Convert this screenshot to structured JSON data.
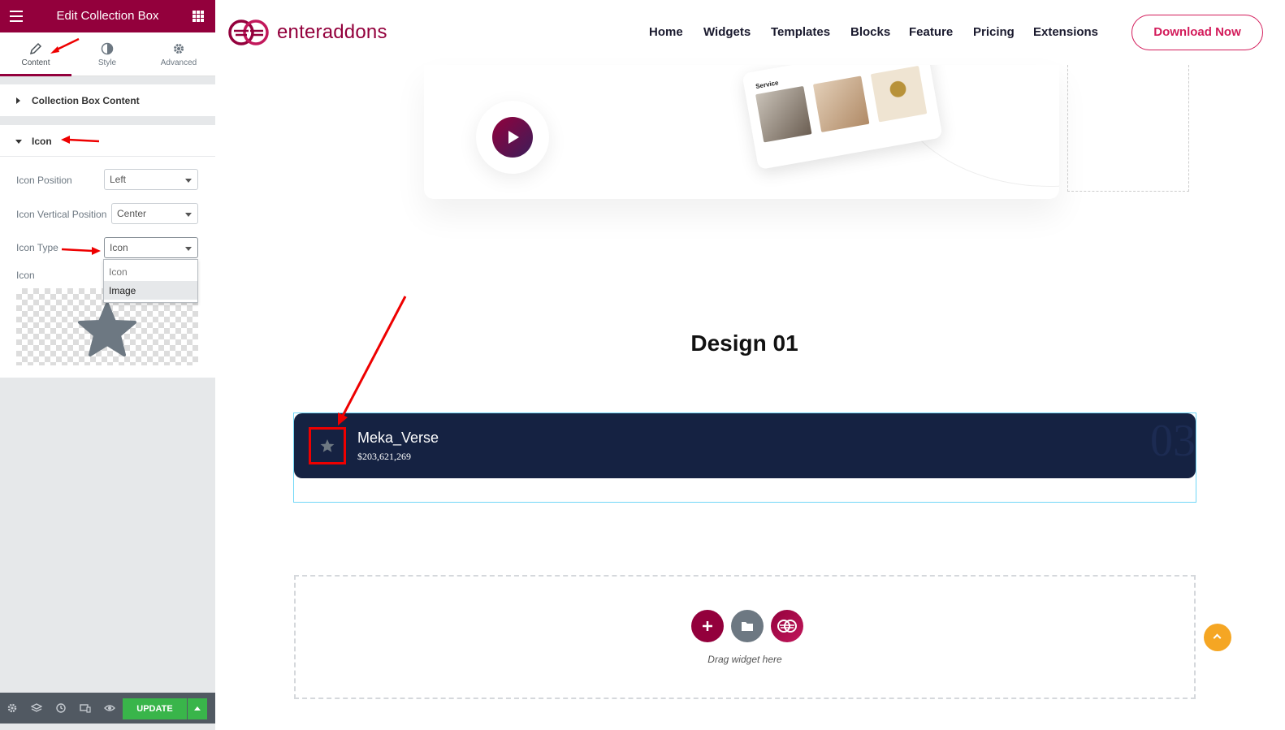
{
  "sidebar": {
    "title": "Edit Collection Box",
    "tabs": [
      {
        "label": "Content",
        "icon": "pencil-icon"
      },
      {
        "label": "Style",
        "icon": "half-circle-icon"
      },
      {
        "label": "Advanced",
        "icon": "gear-icon"
      }
    ],
    "sections": {
      "collection_box_content": "Collection Box Content",
      "icon": "Icon"
    },
    "controls": {
      "icon_position": {
        "label": "Icon Position",
        "value": "Left"
      },
      "icon_vertical_position": {
        "label": "Icon Vertical Position",
        "value": "Center"
      },
      "icon_type": {
        "label": "Icon Type",
        "value": "Icon",
        "options": [
          "Icon",
          "Image"
        ]
      },
      "icon": {
        "label": "Icon",
        "selected_icon": "star-icon"
      }
    },
    "footer": {
      "update_label": "UPDATE"
    },
    "accent_color": "#93003c"
  },
  "site": {
    "logo_text": "enteraddons",
    "nav": [
      "Home",
      "Widgets",
      "Templates",
      "Blocks",
      "Feature",
      "Pricing",
      "Extensions"
    ],
    "cta_label": "Download Now",
    "cta_color": "#d31c5b"
  },
  "hero": {
    "tablet_label": "Service"
  },
  "design": {
    "title": "Design 01"
  },
  "collection_box": {
    "title": "Meka_Verse",
    "price": "$203,621,269",
    "number": "03",
    "icon": "star-icon",
    "background": "#152242"
  },
  "drop_zone": {
    "text": "Drag widget here"
  }
}
